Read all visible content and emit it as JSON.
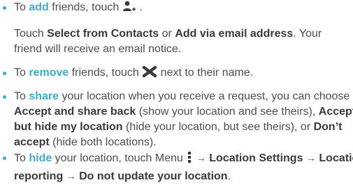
{
  "items": [
    {
      "lead": "To ",
      "keyword": "add",
      "text": " friends, touch ",
      "icon": "add-person-icon",
      "tail": " .",
      "sub_parts": [
        {
          "t": "Touch "
        },
        {
          "b": "Select from Contacts"
        },
        {
          "t": " or "
        },
        {
          "b": "Add via email address"
        },
        {
          "t": ". Your friend will receive an email notice."
        }
      ]
    },
    {
      "lead": "To ",
      "keyword": "remove",
      "text": " friends, touch ",
      "icon": "remove-x-icon",
      "tail": " next to their name."
    },
    {
      "lead": "To ",
      "keyword": "share",
      "text": " your location when you receive a request, you can choose ",
      "b1": "Accept and share back",
      "t1": " (show your location and see theirs), ",
      "b2": "Accept, but hide my location",
      "t2": " (hide your location, but see theirs), or ",
      "b3": "Don’t accept",
      "t3": " (hide both locations)."
    },
    {
      "lead": "To ",
      "keyword": "hide",
      "text": " your location, touch Menu ",
      "icon": "menu-dots-icon",
      "arrow": "→",
      "b1": "Location Settings",
      "b2": "Location reporting",
      "b3": "Do not update your location",
      "tail": "."
    }
  ],
  "colors": {
    "accent": "#3fa9c8",
    "text": "#4d4d4d"
  }
}
